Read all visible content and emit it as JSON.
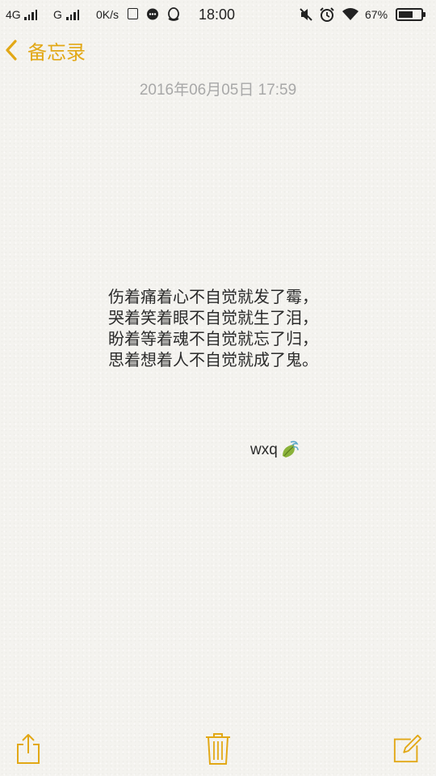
{
  "status_bar": {
    "network_1": "4G",
    "network_2": "G",
    "speed": "0K/s",
    "time": "18:00",
    "battery_percent": "67%",
    "battery_level": 0.67
  },
  "nav": {
    "back_label": "备忘录"
  },
  "note": {
    "date": "2016年06月05日 17:59",
    "lines": [
      "伤着痛着心不自觉就发了霉，",
      "哭着笑着眼不自觉就生了泪，",
      "盼着等着魂不自觉就忘了归，",
      "思着想着人不自觉就成了鬼。"
    ],
    "signature": "wxq"
  },
  "colors": {
    "accent": "#e2a816",
    "text": "#2b2b2b",
    "date": "#a8a8a8",
    "background": "#f4f3ef"
  },
  "icons": {
    "share": "share-icon",
    "delete": "trash-icon",
    "compose": "compose-icon",
    "back": "chevron-left-icon",
    "signature_emoji": "leaf-tea-icon"
  }
}
